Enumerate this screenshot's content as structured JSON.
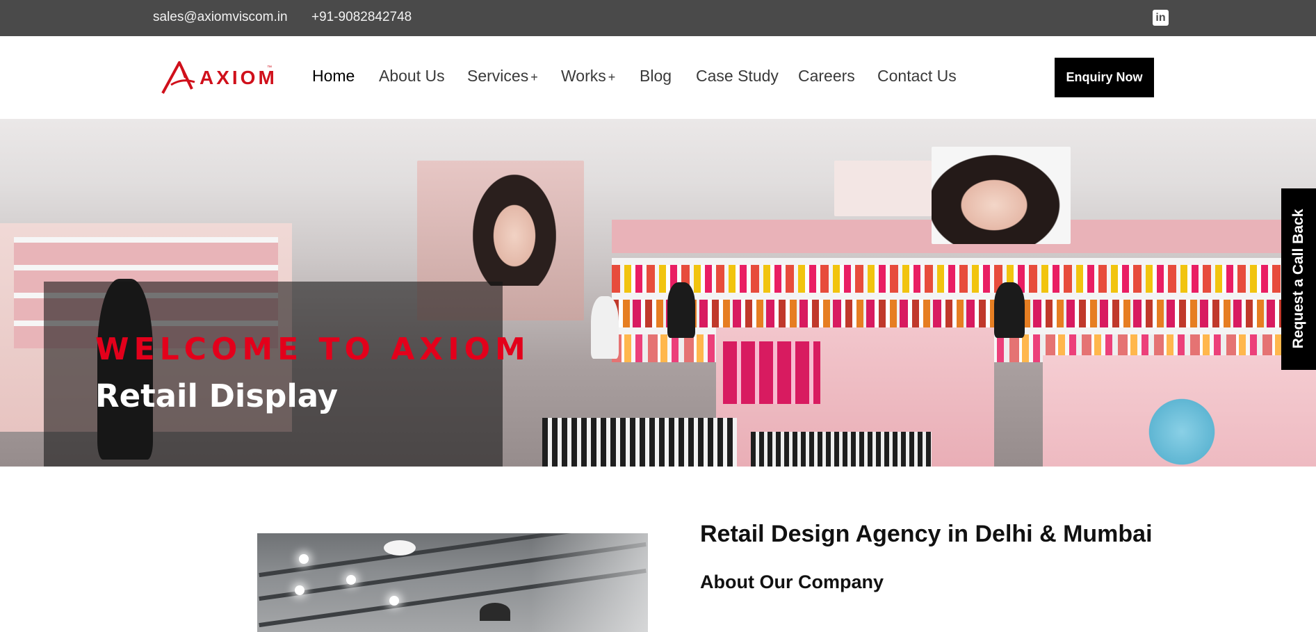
{
  "topbar": {
    "email": "sales@axiomviscom.in",
    "phone": "+91-9082842748",
    "social_icon": "linkedin-icon",
    "social_glyph": "in"
  },
  "brand": {
    "name": "AXIOM",
    "trademark": "™",
    "color": "#d0101b"
  },
  "nav": {
    "items": [
      {
        "label": "Home",
        "active": true,
        "has_submenu": false
      },
      {
        "label": "About Us",
        "active": false,
        "has_submenu": false
      },
      {
        "label": "Services",
        "active": false,
        "has_submenu": true
      },
      {
        "label": "Works",
        "active": false,
        "has_submenu": true
      },
      {
        "label": "Blog",
        "active": false,
        "has_submenu": false
      },
      {
        "label": "Case Study",
        "active": false,
        "has_submenu": false
      },
      {
        "label": "Careers",
        "active": false,
        "has_submenu": false
      },
      {
        "label": "Contact Us",
        "active": false,
        "has_submenu": false
      }
    ],
    "submenu_marker": "+",
    "cta_label": "Enquiry Now"
  },
  "hero": {
    "eyebrow": "WELCOME TO AXIOM",
    "title": "Retail Display",
    "accent_color": "#e3001b"
  },
  "callback": {
    "label": "Request a Call Back"
  },
  "about": {
    "heading": "Retail Design Agency in Delhi & Mumbai",
    "subheading": "About Our Company"
  }
}
